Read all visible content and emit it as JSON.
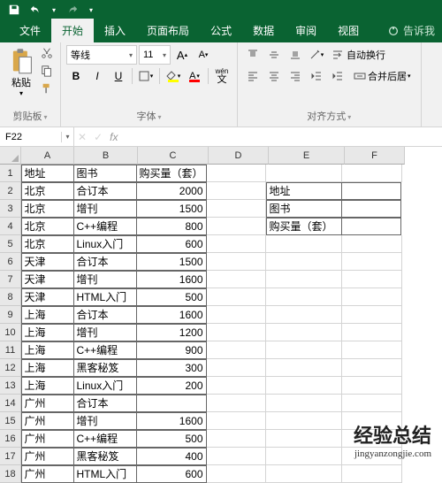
{
  "qat": {
    "save": "save",
    "undo": "undo",
    "redo": "redo"
  },
  "tabs": {
    "file": "文件",
    "home": "开始",
    "insert": "插入",
    "layout": "页面布局",
    "formulas": "公式",
    "data": "数据",
    "review": "审阅",
    "view": "视图",
    "tellme": "告诉我"
  },
  "ribbon": {
    "clipboard": {
      "paste": "粘贴",
      "label": "剪贴板"
    },
    "font": {
      "name": "等线",
      "size": "11",
      "label": "字体",
      "ruby": "wén"
    },
    "alignment": {
      "wrap": "自动换行",
      "merge": "合并后居",
      "label": "对齐方式"
    }
  },
  "namebox": {
    "ref": "F22",
    "cancel": "✕",
    "confirm": "✓",
    "fx": "fx"
  },
  "columns": [
    "A",
    "B",
    "C",
    "D",
    "E",
    "F"
  ],
  "rows": [
    "1",
    "2",
    "3",
    "4",
    "5",
    "6",
    "7",
    "8",
    "9",
    "10",
    "11",
    "12",
    "13",
    "14",
    "15",
    "16",
    "17",
    "18"
  ],
  "cells": {
    "A": [
      "地址",
      "北京",
      "北京",
      "北京",
      "北京",
      "天津",
      "天津",
      "天津",
      "上海",
      "上海",
      "上海",
      "上海",
      "上海",
      "广州",
      "广州",
      "广州",
      "广州",
      "广州"
    ],
    "B": [
      "图书",
      "合订本",
      "增刊",
      "C++编程",
      "Linux入门",
      "合订本",
      "增刊",
      "HTML入门",
      "合订本",
      "增刊",
      "C++编程",
      "黑客秘笈",
      "Linux入门",
      "合订本",
      "增刊",
      "C++编程",
      "黑客秘笈",
      "HTML入门"
    ],
    "C": [
      "购买量（套）",
      "2000",
      "1500",
      "800",
      "600",
      "1500",
      "1600",
      "500",
      "1600",
      "1200",
      "900",
      "300",
      "200",
      "1600",
      "500",
      "400",
      "600",
      ""
    ],
    "C_header": "购买量（套）",
    "C_vals": [
      "2000",
      "1500",
      "800",
      "600",
      "1500",
      "1600",
      "500",
      "1600",
      "1200",
      "900",
      "300",
      "200",
      "",
      "1600",
      "500",
      "400",
      "600"
    ]
  },
  "side": {
    "E2": "地址",
    "E3": "图书",
    "E4": "购买量（套）"
  },
  "watermark": {
    "title": "经验总结",
    "url": "jingyanzongjie.com"
  }
}
